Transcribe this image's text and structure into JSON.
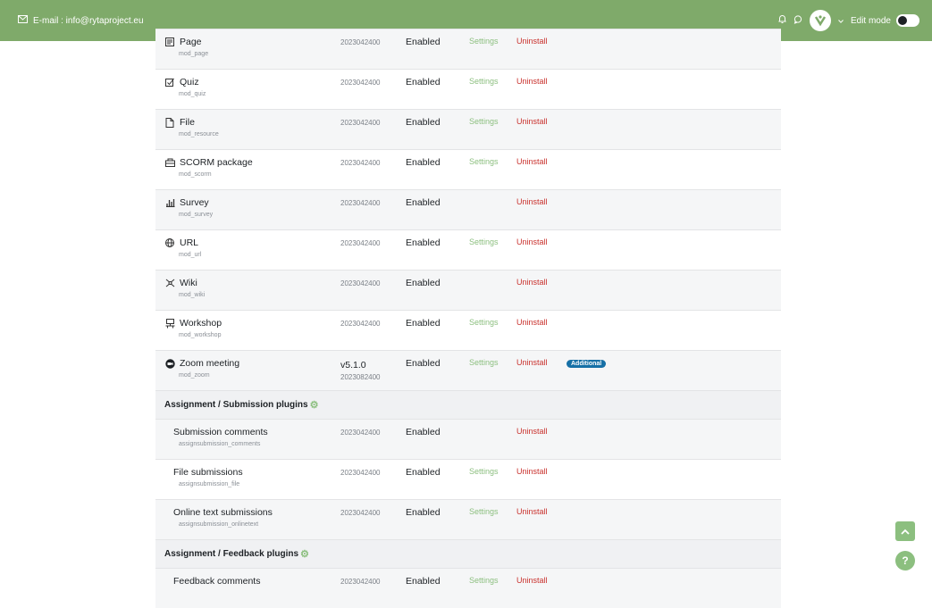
{
  "topbar": {
    "email": "E-mail : info@rytaproject.eu",
    "edit_mode": "Edit mode"
  },
  "labels": {
    "enabled": "Enabled",
    "settings": "Settings",
    "uninstall": "Uninstall",
    "additional": "Additional"
  },
  "modules": [
    {
      "name": "Page",
      "component": "mod_page",
      "version": "2023042400",
      "icon": "page-icon"
    },
    {
      "name": "Quiz",
      "component": "mod_quiz",
      "version": "2023042400",
      "icon": "quiz-icon"
    },
    {
      "name": "File",
      "component": "mod_resource",
      "version": "2023042400",
      "icon": "file-icon"
    },
    {
      "name": "SCORM package",
      "component": "mod_scorm",
      "version": "2023042400",
      "icon": "scorm-icon"
    },
    {
      "name": "Survey",
      "component": "mod_survey",
      "version": "2023042400",
      "icon": "survey-icon"
    },
    {
      "name": "URL",
      "component": "mod_url",
      "version": "2023042400",
      "icon": "url-icon"
    },
    {
      "name": "Wiki",
      "component": "mod_wiki",
      "version": "2023042400",
      "icon": "wiki-icon"
    },
    {
      "name": "Workshop",
      "component": "mod_workshop",
      "version": "2023042400",
      "icon": "workshop-icon"
    },
    {
      "name": "Zoom meeting",
      "component": "mod_zoom",
      "version": "v5.1.0",
      "version2": "2023082400",
      "icon": "zoom-icon"
    }
  ],
  "sections": {
    "submission": "Assignment / Submission plugins",
    "feedback": "Assignment / Feedback plugins"
  },
  "submission_plugins": [
    {
      "name": "Submission comments",
      "component": "assignsubmission_comments",
      "version": "2023042400"
    },
    {
      "name": "File submissions",
      "component": "assignsubmission_file",
      "version": "2023042400"
    },
    {
      "name": "Online text submissions",
      "component": "assignsubmission_onlinetext",
      "version": "2023042400"
    }
  ],
  "feedback_plugins": [
    {
      "name": "Feedback comments",
      "version": "2023042400"
    }
  ],
  "colors": {
    "topbar": "#7faa6a",
    "settings": "#8cbf7f",
    "uninstall": "#c9302c",
    "badge": "#1670a6"
  }
}
